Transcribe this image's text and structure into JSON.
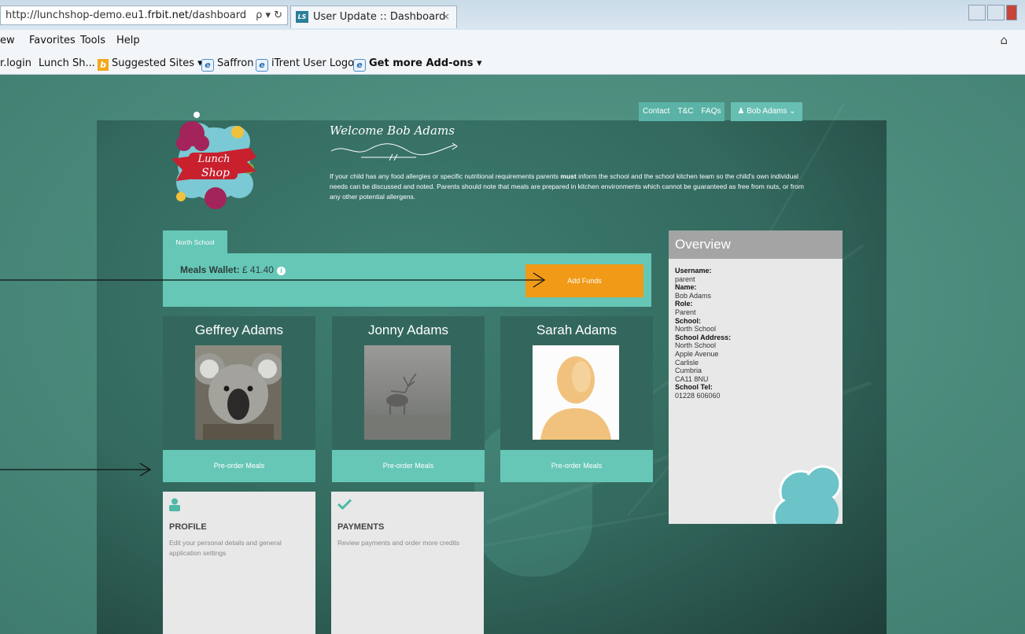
{
  "browser": {
    "url_prefix": "http://lunchshop-demo.eu1.",
    "url_host": "frbit.net",
    "url_path": "/dashboard",
    "address_controls": "ρ ▾ ↻",
    "tab_icon": "LS",
    "tab_title": "User Update :: Dashboard",
    "tab_close": "×",
    "menu": [
      "ew",
      "Favorites",
      "Tools",
      "Help"
    ],
    "favorites": {
      "item1": "r.login",
      "item2": "Lunch Sh...",
      "item3": "Suggested Sites ▾",
      "item4": "Saffron",
      "item5": "iTrent User Logon",
      "item6": "Get more Add-ons ▾"
    }
  },
  "nav": {
    "contact": "Contact",
    "tc": "T&C",
    "faqs": "FAQs",
    "user": "Bob Adams ⌄"
  },
  "logo": {
    "line1": "Lunch",
    "line2": "Shop"
  },
  "welcome": {
    "title": "Welcome Bob Adams",
    "text_before": "If your child has any food allergies or specific nutritional requirements parents ",
    "text_bold": "must",
    "text_after": " inform the school and the school kitchen team so the child's own individual needs can be discussed and noted. Parents should note that meals are prepared in kitchen environments which cannot be guaranteed as free from nuts, or from any other potential allergens."
  },
  "school_tab": "North School",
  "wallet": {
    "label": "Meals Wallet:",
    "amount": "£ 41.40",
    "add_funds": "Add Funds"
  },
  "children": [
    {
      "name": "Geffrey Adams",
      "button": "Pre-order Meals",
      "photo": "koala"
    },
    {
      "name": "Jonny Adams",
      "button": "Pre-order Meals",
      "photo": "deer-in-fog"
    },
    {
      "name": "Sarah Adams",
      "button": "Pre-order Meals",
      "photo": "default-avatar"
    }
  ],
  "tiles": [
    {
      "icon": "user-icon",
      "title": "PROFILE",
      "desc": "Edit your personal details and general application settings"
    },
    {
      "icon": "check-icon",
      "title": "PAYMENTS",
      "desc": "Review payments and order more credits"
    }
  ],
  "overview": {
    "title": "Overview",
    "username_label": "Username:",
    "username": "parent",
    "name_label": "Name:",
    "name": "Bob Adams",
    "role_label": "Role:",
    "role": "Parent",
    "school_label": "School:",
    "school": "North School",
    "address_label": "School Address:",
    "address": [
      "North School",
      "Apple Avenue",
      "Carlisle",
      "Cumbria",
      "CA11 8NU"
    ],
    "tel_label": "School Tel:",
    "tel": "01228 606060"
  },
  "colors": {
    "accent_teal": "#66c7b7",
    "orange": "#f09a17",
    "panel_dark": "#33675d"
  }
}
